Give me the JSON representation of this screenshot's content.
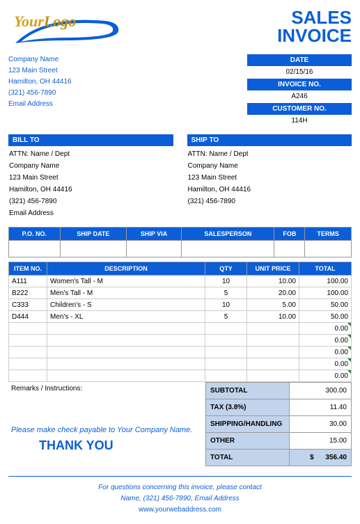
{
  "title_line1": "SALES",
  "title_line2": "INVOICE",
  "logo_text": "YourLogo",
  "company": {
    "name": "Company Name",
    "street": "123 Main Street",
    "citystate": "Hamilton, OH  44416",
    "phone": "(321) 456-7890",
    "email": "Email Address"
  },
  "meta": {
    "date_label": "DATE",
    "date": "02/15/16",
    "invoice_label": "INVOICE NO.",
    "invoice": "A246",
    "customer_label": "CUSTOMER NO.",
    "customer": "114H"
  },
  "billto_label": "BILL TO",
  "shipto_label": "SHIP TO",
  "billto": {
    "attn": "ATTN: Name / Dept",
    "company": "Company Name",
    "street": "123 Main Street",
    "citystate": "Hamilton, OH  44416",
    "phone": "(321) 456-7890",
    "email": "Email Address"
  },
  "shipto": {
    "attn": "ATTN: Name / Dept",
    "company": "Company Name",
    "street": "123 Main Street",
    "citystate": "Hamilton, OH  44416",
    "phone": "(321) 456-7890"
  },
  "ship_headers": {
    "po": "P.O. NO.",
    "shipdate": "SHIP DATE",
    "shipvia": "SHIP VIA",
    "salesperson": "SALESPERSON",
    "fob": "FOB",
    "terms": "TERMS"
  },
  "item_headers": {
    "itemno": "ITEM NO.",
    "desc": "DESCRIPTION",
    "qty": "QTY",
    "unit": "UNIT PRICE",
    "total": "TOTAL"
  },
  "items": [
    {
      "no": "A111",
      "desc": "Women's Tall - M",
      "qty": "10",
      "unit": "10.00",
      "total": "100.00"
    },
    {
      "no": "B222",
      "desc": "Men's Tall - M",
      "qty": "5",
      "unit": "20.00",
      "total": "100.00"
    },
    {
      "no": "C333",
      "desc": "Children's - S",
      "qty": "10",
      "unit": "5.00",
      "total": "50.00"
    },
    {
      "no": "D444",
      "desc": "Men's - XL",
      "qty": "5",
      "unit": "10.00",
      "total": "50.00"
    }
  ],
  "empty_totals": [
    "0.00",
    "0.00",
    "0.00",
    "0.00",
    "0.00"
  ],
  "remarks_label": "Remarks / Instructions:",
  "payable": "Please make check payable to Your Company Name.",
  "thanks": "THANK YOU",
  "totals": {
    "subtotal_label": "SUBTOTAL",
    "subtotal": "300.00",
    "tax_label": "TAX (3.8%)",
    "tax": "11.40",
    "shipping_label": "SHIPPING/HANDLING",
    "shipping": "30.00",
    "other_label": "OTHER",
    "other": "15.00",
    "total_label": "TOTAL",
    "total_currency": "$",
    "total": "356.40"
  },
  "footer": {
    "line1": "For questions concerning this invoice, please contact",
    "line2": "Name, (321) 456-7890, Email Address",
    "web": "www.yourwebaddress.com"
  }
}
